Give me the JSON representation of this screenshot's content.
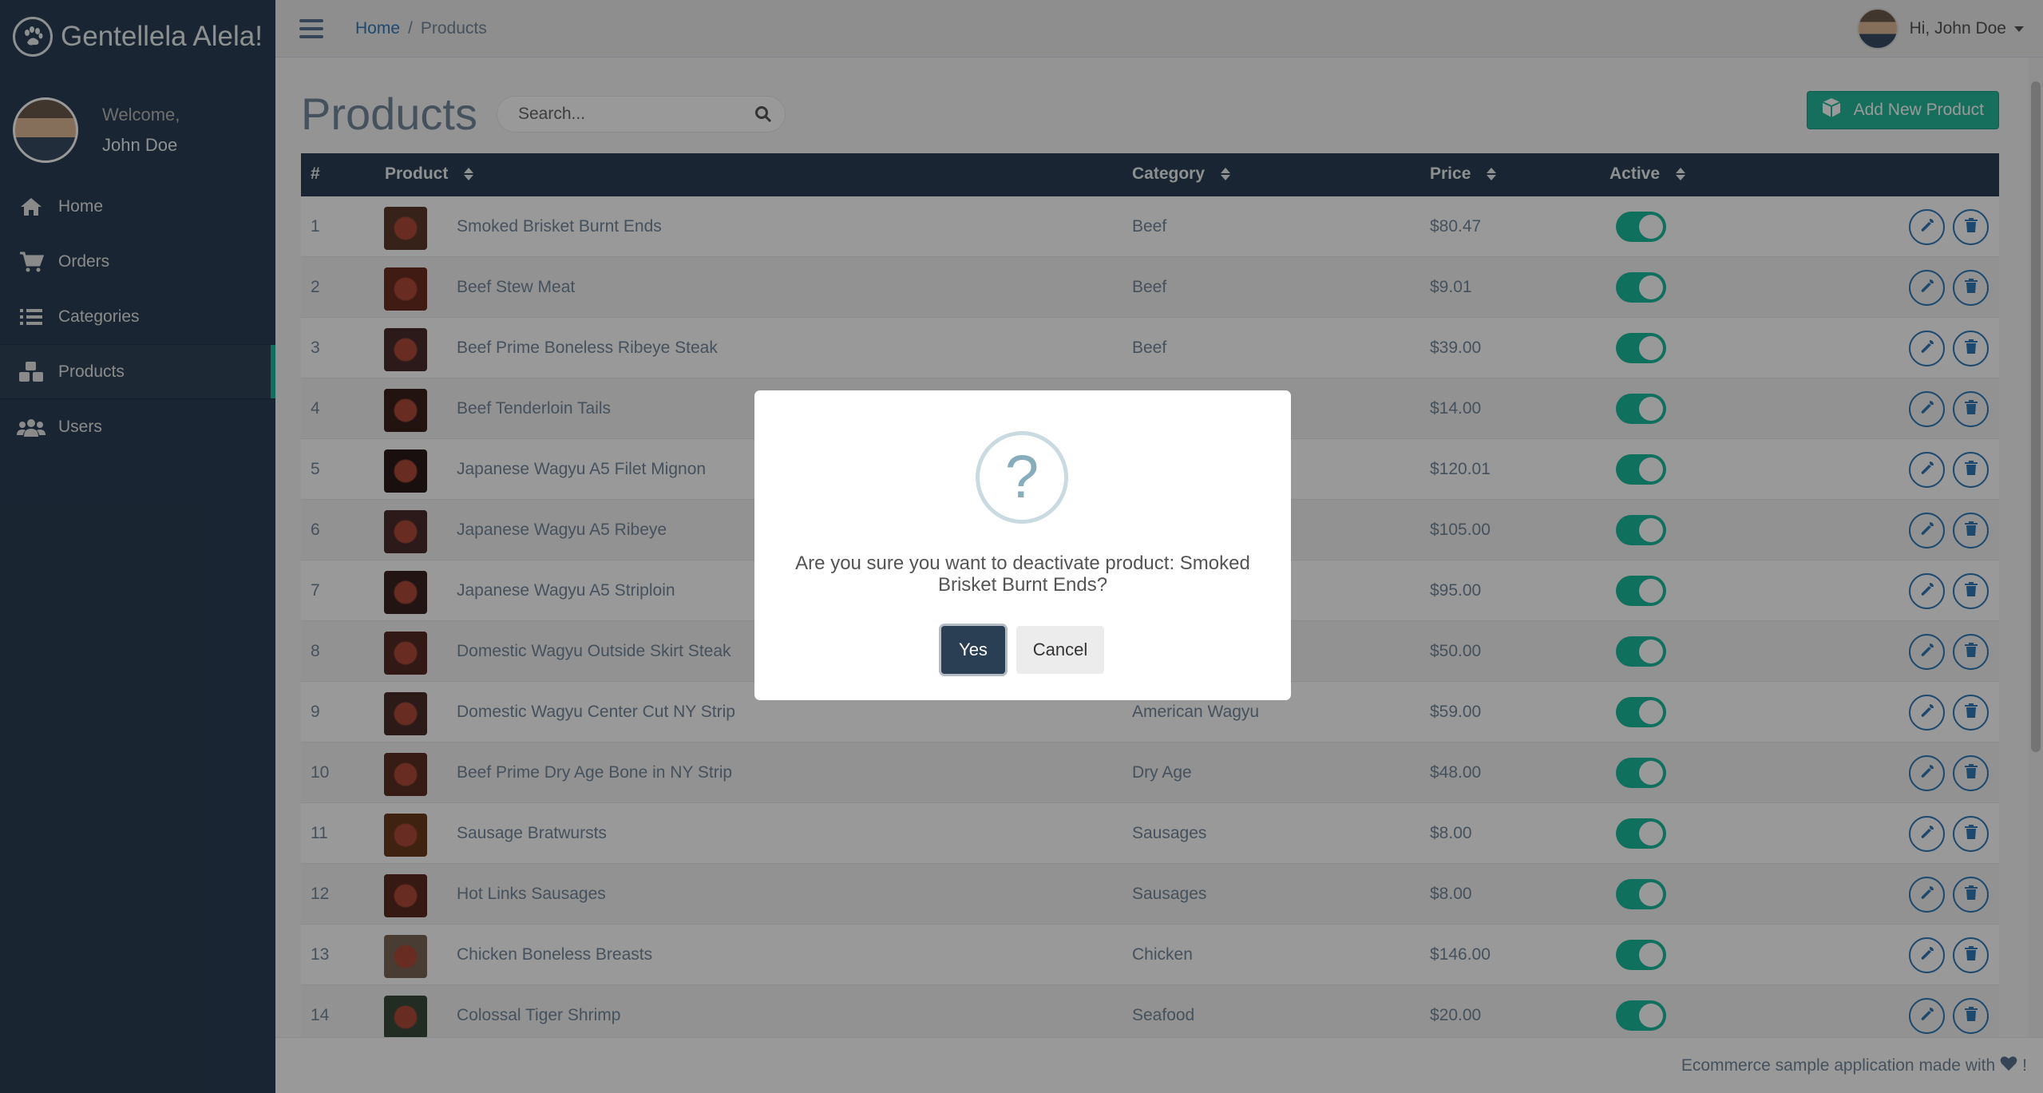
{
  "app": {
    "brand_title": "Gentellela Alela!",
    "welcome": "Welcome,",
    "user_name": "John Doe",
    "greeting": "Hi, John Doe"
  },
  "sidebar": {
    "items": [
      {
        "label": "Home",
        "icon": "home-icon"
      },
      {
        "label": "Orders",
        "icon": "cart-icon"
      },
      {
        "label": "Categories",
        "icon": "list-icon"
      },
      {
        "label": "Products",
        "icon": "cubes-icon",
        "active": true
      },
      {
        "label": "Users",
        "icon": "users-icon"
      }
    ]
  },
  "breadcrumb": {
    "home": "Home",
    "sep": "/",
    "current": "Products"
  },
  "page": {
    "title": "Products",
    "search_placeholder": "Search...",
    "add_button": "Add New Product"
  },
  "table": {
    "headers": {
      "num": "#",
      "product": "Product",
      "category": "Category",
      "price": "Price",
      "active": "Active"
    },
    "rows": [
      {
        "num": "1",
        "name": "Smoked Brisket Burnt Ends",
        "category": "Beef",
        "price": "$80.47",
        "active": true
      },
      {
        "num": "2",
        "name": "Beef Stew Meat",
        "category": "Beef",
        "price": "$9.01",
        "active": true
      },
      {
        "num": "3",
        "name": "Beef Prime Boneless Ribeye Steak",
        "category": "Beef",
        "price": "$39.00",
        "active": true
      },
      {
        "num": "4",
        "name": "Beef Tenderloin Tails",
        "category": "",
        "price": "$14.00",
        "active": true
      },
      {
        "num": "5",
        "name": "Japanese Wagyu A5 Filet Mignon",
        "category": "",
        "price": "$120.01",
        "active": true
      },
      {
        "num": "6",
        "name": "Japanese Wagyu A5 Ribeye",
        "category": "",
        "price": "$105.00",
        "active": true
      },
      {
        "num": "7",
        "name": "Japanese Wagyu A5 Striploin",
        "category": "",
        "price": "$95.00",
        "active": true
      },
      {
        "num": "8",
        "name": "Domestic Wagyu Outside Skirt Steak",
        "category": "",
        "price": "$50.00",
        "active": true
      },
      {
        "num": "9",
        "name": "Domestic Wagyu Center Cut NY Strip",
        "category": "American Wagyu",
        "price": "$59.00",
        "active": true
      },
      {
        "num": "10",
        "name": "Beef Prime Dry Age Bone in NY Strip",
        "category": "Dry Age",
        "price": "$48.00",
        "active": true
      },
      {
        "num": "11",
        "name": "Sausage Bratwursts",
        "category": "Sausages",
        "price": "$8.00",
        "active": true
      },
      {
        "num": "12",
        "name": "Hot Links Sausages",
        "category": "Sausages",
        "price": "$8.00",
        "active": true
      },
      {
        "num": "13",
        "name": "Chicken Boneless Breasts",
        "category": "Chicken",
        "price": "$146.00",
        "active": true
      },
      {
        "num": "14",
        "name": "Colossal Tiger Shrimp",
        "category": "Seafood",
        "price": "$20.00",
        "active": true
      }
    ]
  },
  "footer": {
    "text": "Ecommerce sample application made with",
    "suffix": "!"
  },
  "modal": {
    "icon": "?",
    "message": "Are you sure you want to deactivate product: Smoked Brisket Burnt Ends?",
    "yes": "Yes",
    "cancel": "Cancel"
  },
  "colors": {
    "sidebar": "#2a3f54",
    "accent": "#1abb9c",
    "button_green": "#26b99a",
    "link": "#337ab7"
  }
}
